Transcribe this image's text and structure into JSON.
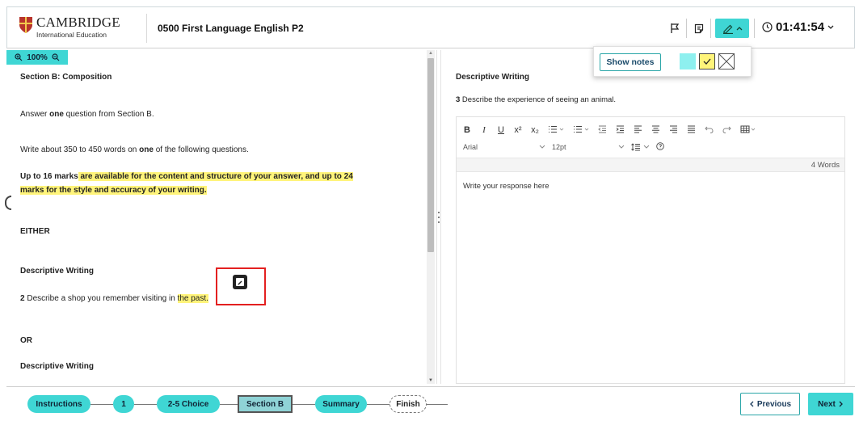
{
  "header": {
    "logo_name": "CAMBRIDGE",
    "logo_sub": "International Education",
    "exam_title": "0500 First Language English P2",
    "timer": "01:41:54"
  },
  "notes_popup": {
    "show_notes_label": "Show notes"
  },
  "zoom": {
    "level": "100%"
  },
  "question_paper": {
    "section_title": "Section B: Composition",
    "instruction_pre": "Answer ",
    "instruction_bold": "one",
    "instruction_post": " question from Section B.",
    "words_pre": "Write about 350 to 450 words on ",
    "words_bold": "one",
    "words_post": " of the following questions.",
    "marks_part1": "Up to 16 marks",
    "marks_part2": " are available for the content and structure of your answer, and up to 24",
    "marks_part3": "marks for the style and accuracy of your writing.",
    "either": "EITHER",
    "q2_heading": "Descriptive Writing",
    "q2_number": "2",
    "q2_text": " Describe a shop you remember visiting in ",
    "q2_highlight": "the past.",
    "or": "OR",
    "q3_heading": "Descriptive Writing"
  },
  "answer": {
    "heading": "Descriptive Writing",
    "question_number": "3",
    "question_text": " Describe the experience of seeing an animal.",
    "font": "Arial",
    "font_size": "12pt",
    "word_count": "4 Words",
    "placeholder": "Write your response here"
  },
  "toolbar": {
    "bold": "B",
    "italic": "I",
    "underline": "U"
  },
  "footer": {
    "steps": [
      "Instructions",
      "1",
      "2-5 Choice",
      "Section B",
      "Summary",
      "Finish"
    ],
    "previous_label": "Previous",
    "next_label": "Next"
  },
  "colors": {
    "accent": "#3fd6d4",
    "highlight": "#fff47a",
    "annotation_border": "#e32020"
  }
}
